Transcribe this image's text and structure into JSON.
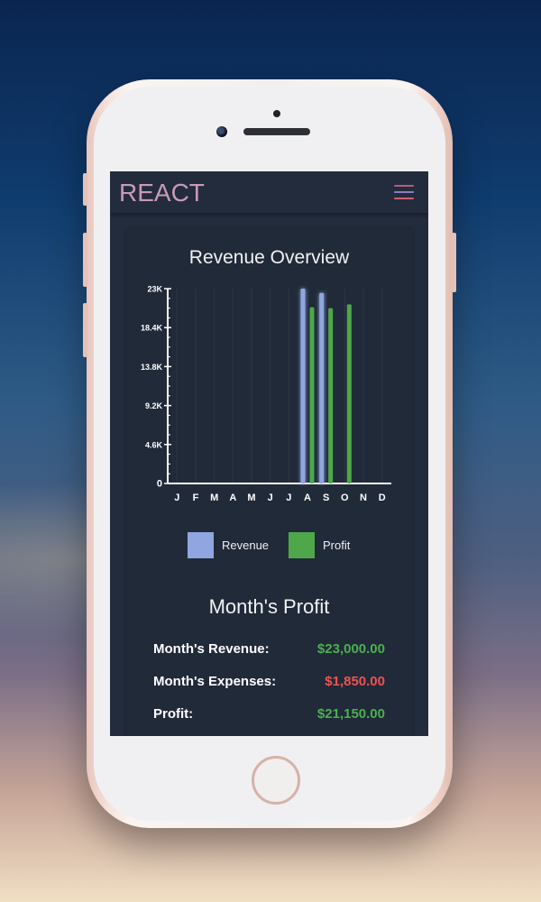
{
  "app": {
    "brand": "REACT",
    "menu_icon": "hamburger-menu-icon"
  },
  "colors": {
    "brand": "#c89ab8",
    "hamburger_top": "#b85a86",
    "hamburger_mid": "#8e7cc0",
    "hamburger_bot": "#cc5f7a",
    "revenue": "#8fa6e0",
    "profit": "#4ea84a",
    "positive": "#4caf50",
    "negative": "#ef5350"
  },
  "chart_data": {
    "type": "bar",
    "title": "Revenue Overview",
    "categories": [
      "J",
      "F",
      "M",
      "A",
      "M",
      "J",
      "J",
      "A",
      "S",
      "O",
      "N",
      "D"
    ],
    "y_ticks": [
      "0",
      "4.6K",
      "9.2K",
      "13.8K",
      "18.4K",
      "23K"
    ],
    "ylim": [
      0,
      23000
    ],
    "series": [
      {
        "name": "Revenue",
        "values": [
          0,
          0,
          0,
          0,
          0,
          0,
          0,
          23000,
          22500,
          0,
          0,
          0
        ]
      },
      {
        "name": "Profit",
        "values": [
          0,
          0,
          0,
          0,
          0,
          0,
          0,
          20800,
          20700,
          21150,
          0,
          0
        ]
      }
    ],
    "legend": "bottom",
    "grid": true
  },
  "summary": {
    "title": "Month's Profit",
    "revenue_label": "Month's Revenue:",
    "revenue_value": "$23,000.00",
    "expenses_label": "Month's Expenses:",
    "expenses_value": "$1,850.00",
    "profit_label": "Profit:",
    "profit_value": "$21,150.00"
  }
}
